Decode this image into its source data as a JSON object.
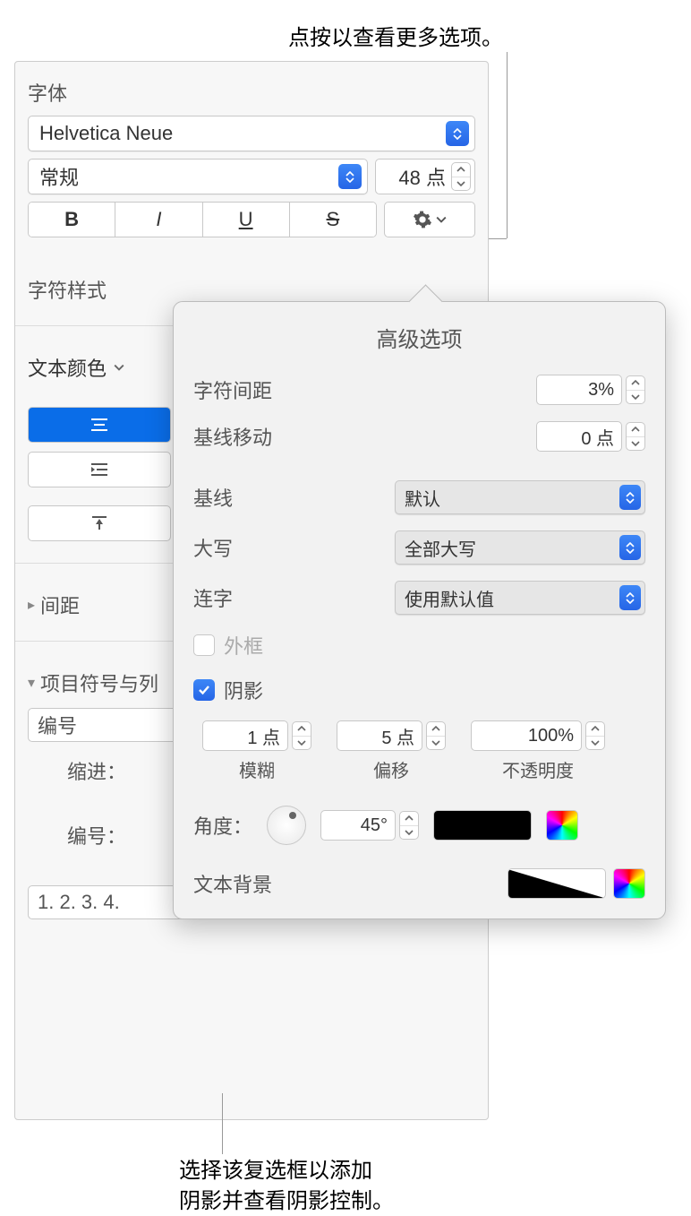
{
  "callout_top": "点按以查看更多选项。",
  "callout_bottom_line1": "选择该复选框以添加",
  "callout_bottom_line2": "阴影并查看阴影控制。",
  "panel": {
    "font_section": "字体",
    "font_name": "Helvetica Neue",
    "font_style": "常规",
    "font_size": "48 点",
    "char_style": "字符样式",
    "text_color": "文本颜色",
    "spacing": "间距",
    "bullets": "项目符号与列",
    "number_label": "编号",
    "indent_label": "缩进：",
    "numbering_label": "编号：",
    "list_format": "1. 2. 3. 4."
  },
  "popover": {
    "title": "高级选项",
    "char_spacing_label": "字符间距",
    "char_spacing_value": "3%",
    "baseline_shift_label": "基线移动",
    "baseline_shift_value": "0 点",
    "baseline_label": "基线",
    "baseline_value": "默认",
    "caps_label": "大写",
    "caps_value": "全部大写",
    "ligature_label": "连字",
    "ligature_value": "使用默认值",
    "outline_label": "外框",
    "shadow_label": "阴影",
    "blur_value": "1 点",
    "blur_label": "模糊",
    "offset_value": "5 点",
    "offset_label": "偏移",
    "opacity_value": "100%",
    "opacity_label": "不透明度",
    "angle_label": "角度：",
    "angle_value": "45°",
    "text_bg_label": "文本背景"
  },
  "style_buttons": {
    "bold": "B",
    "italic": "I",
    "underline": "U",
    "strike": "S"
  }
}
